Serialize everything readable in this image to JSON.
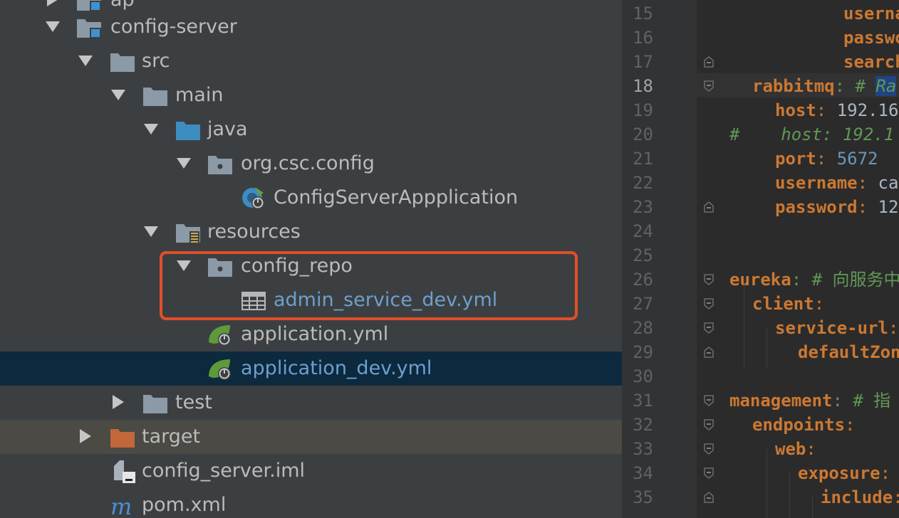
{
  "project_tree": {
    "rows": [
      {
        "label": "ap",
        "arrow": "right",
        "icon": "module-folder-icon"
      },
      {
        "label": "config-server",
        "arrow": "down",
        "icon": "module-folder-icon"
      },
      {
        "label": "src",
        "arrow": "down",
        "icon": "folder-icon"
      },
      {
        "label": "main",
        "arrow": "down",
        "icon": "folder-icon"
      },
      {
        "label": "java",
        "arrow": "down",
        "icon": "source-folder-icon"
      },
      {
        "label": "org.csc.config",
        "arrow": "down",
        "icon": "package-icon"
      },
      {
        "label": "ConfigServerAppplication",
        "arrow": "none",
        "icon": "spring-boot-class-icon"
      },
      {
        "label": "resources",
        "arrow": "down",
        "icon": "resources-folder-icon"
      },
      {
        "label": "config_repo",
        "arrow": "down",
        "icon": "package-icon"
      },
      {
        "label": "admin_service_dev.yml",
        "arrow": "none",
        "icon": "table-file-icon"
      },
      {
        "label": "application.yml",
        "arrow": "none",
        "icon": "spring-config-icon"
      },
      {
        "label": "application_dev.yml",
        "arrow": "none",
        "icon": "spring-config-icon"
      },
      {
        "label": "test",
        "arrow": "right",
        "icon": "folder-icon"
      },
      {
        "label": "target",
        "arrow": "right",
        "icon": "excluded-folder-icon"
      },
      {
        "label": "config_server.iml",
        "arrow": "none",
        "icon": "iml-file-icon"
      },
      {
        "label": "pom.xml",
        "arrow": "none",
        "icon": "maven-icon"
      }
    ],
    "selected_row": "application_dev.yml",
    "highlight_color": "#e0502a"
  },
  "editor": {
    "current_line": "18",
    "lines": [
      {
        "num": "15",
        "segs": [
          {
            "t": "username",
            "c": "k"
          }
        ]
      },
      {
        "num": "16",
        "segs": [
          {
            "t": "password",
            "c": "k"
          }
        ]
      },
      {
        "num": "17",
        "segs": [
          {
            "t": "search",
            "c": "k"
          }
        ]
      },
      {
        "num": "18",
        "segs": [
          {
            "t": "rabbitmq",
            "c": "k"
          },
          {
            "t": ": # ",
            "c": "cm"
          },
          {
            "t": "Ra",
            "c": "c"
          }
        ]
      },
      {
        "num": "19",
        "segs": [
          {
            "t": "host",
            "c": "k"
          },
          {
            "t": ": ",
            "c": "p"
          },
          {
            "t": "192.16",
            "c": "v"
          }
        ]
      },
      {
        "num": "20",
        "segs": [
          {
            "t": "#    host: 192.1",
            "c": "c"
          }
        ]
      },
      {
        "num": "21",
        "segs": [
          {
            "t": "port",
            "c": "k"
          },
          {
            "t": ": ",
            "c": "p"
          },
          {
            "t": "5672",
            "c": "n"
          }
        ]
      },
      {
        "num": "22",
        "segs": [
          {
            "t": "username",
            "c": "k"
          },
          {
            "t": ": ",
            "c": "p"
          },
          {
            "t": "ca",
            "c": "v"
          }
        ]
      },
      {
        "num": "23",
        "segs": [
          {
            "t": "password",
            "c": "k"
          },
          {
            "t": ": ",
            "c": "p"
          },
          {
            "t": "12",
            "c": "v"
          }
        ]
      },
      {
        "num": "24",
        "segs": []
      },
      {
        "num": "25",
        "segs": []
      },
      {
        "num": "26",
        "segs": [
          {
            "t": "eureka",
            "c": "k"
          },
          {
            "t": ": # 向服务中",
            "c": "cm"
          }
        ]
      },
      {
        "num": "27",
        "segs": [
          {
            "t": "client",
            "c": "k"
          },
          {
            "t": ":",
            "c": "p"
          }
        ]
      },
      {
        "num": "28",
        "segs": [
          {
            "t": "service-url",
            "c": "k"
          },
          {
            "t": ":",
            "c": "p"
          }
        ]
      },
      {
        "num": "29",
        "segs": [
          {
            "t": "defaultZon",
            "c": "k"
          }
        ]
      },
      {
        "num": "30",
        "segs": []
      },
      {
        "num": "31",
        "segs": [
          {
            "t": "management",
            "c": "k"
          },
          {
            "t": ": # 指",
            "c": "cm"
          }
        ]
      },
      {
        "num": "32",
        "segs": [
          {
            "t": "endpoints",
            "c": "k"
          },
          {
            "t": ":",
            "c": "p"
          }
        ]
      },
      {
        "num": "33",
        "segs": [
          {
            "t": "web",
            "c": "k"
          },
          {
            "t": ":",
            "c": "p"
          }
        ]
      },
      {
        "num": "34",
        "segs": [
          {
            "t": "exposure",
            "c": "k"
          },
          {
            "t": ":",
            "c": "p"
          }
        ]
      },
      {
        "num": "35",
        "segs": [
          {
            "t": "include",
            "c": "k"
          },
          {
            "t": ":",
            "c": "p"
          }
        ]
      }
    ]
  }
}
